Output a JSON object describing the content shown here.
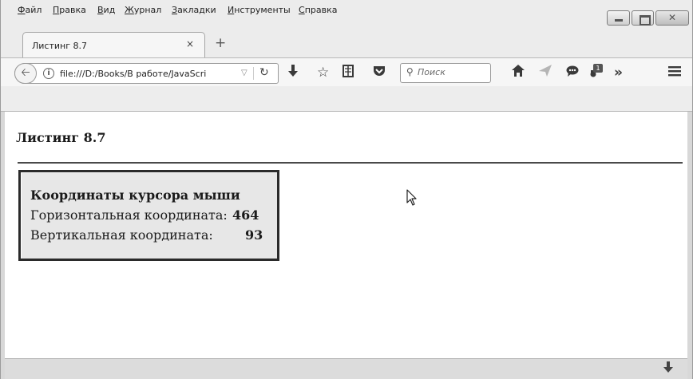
{
  "menubar": {
    "items": [
      {
        "label": "Файл",
        "key": "Ф",
        "rest": "айл"
      },
      {
        "label": "Правка",
        "key": "П",
        "rest": "равка"
      },
      {
        "label": "Вид",
        "key": "В",
        "rest": "ид"
      },
      {
        "label": "Журнал",
        "key": "Ж",
        "rest": "урнал"
      },
      {
        "label": "Закладки",
        "key": "З",
        "rest": "акладки"
      },
      {
        "label": "Инструменты",
        "key": "И",
        "rest": "нструменты"
      },
      {
        "label": "Справка",
        "key": "С",
        "rest": "правка"
      }
    ]
  },
  "tab": {
    "title": "Листинг 8.7",
    "close_glyph": "×",
    "new_tab_glyph": "+"
  },
  "navbar": {
    "url": "file:///D:/Books/В работе/JavaScri",
    "search_placeholder": "Поиск",
    "badge_count": "1"
  },
  "page": {
    "heading": "Листинг 8.7",
    "coords": {
      "title": "Координаты курсора мыши",
      "horizontal_label": "Горизонтальная координата:",
      "horizontal_value": "464",
      "vertical_label": "Вертикальная координата:",
      "vertical_value": "93"
    }
  },
  "colors": {
    "chrome_bg": "#ececec",
    "box_bg": "#e7e7e7",
    "box_border": "#2a2a2a",
    "rule": "#4a4a4a"
  }
}
